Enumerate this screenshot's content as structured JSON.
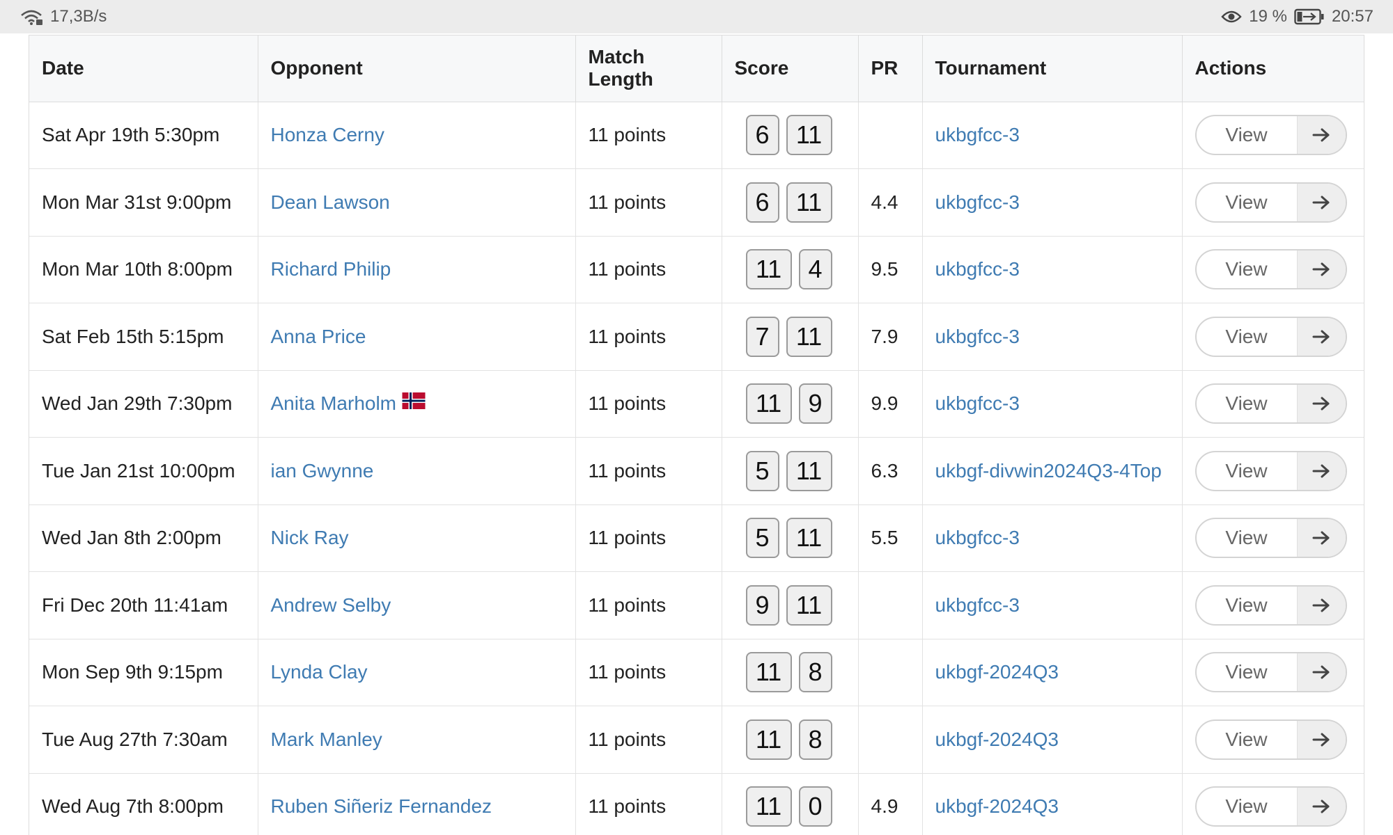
{
  "statusbar": {
    "net_speed": "17,3B/s",
    "battery_percent": "19 %",
    "time": "20:57"
  },
  "table": {
    "headers": {
      "date": "Date",
      "opponent": "Opponent",
      "match_length": "Match Length",
      "score": "Score",
      "pr": "PR",
      "tournament": "Tournament",
      "actions": "Actions"
    },
    "view_label": "View",
    "rows": [
      {
        "date": "Sat Apr 19th 5:30pm",
        "opponent": "Honza Cerny",
        "length": "11 points",
        "score_a": "6",
        "score_b": "11",
        "pr": "",
        "tournament": "ukbgfcc-3"
      },
      {
        "date": "Mon Mar 31st 9:00pm",
        "opponent": "Dean Lawson",
        "length": "11 points",
        "score_a": "6",
        "score_b": "11",
        "pr": "4.4",
        "tournament": "ukbgfcc-3"
      },
      {
        "date": "Mon Mar 10th 8:00pm",
        "opponent": "Richard Philip",
        "length": "11 points",
        "score_a": "11",
        "score_b": "4",
        "pr": "9.5",
        "tournament": "ukbgfcc-3"
      },
      {
        "date": "Sat Feb 15th 5:15pm",
        "opponent": "Anna Price",
        "length": "11 points",
        "score_a": "7",
        "score_b": "11",
        "pr": "7.9",
        "tournament": "ukbgfcc-3"
      },
      {
        "date": "Wed Jan 29th 7:30pm",
        "opponent": "Anita Marholm",
        "length": "11 points",
        "score_a": "11",
        "score_b": "9",
        "pr": "9.9",
        "tournament": "ukbgfcc-3",
        "flag": "norway-flag-icon"
      },
      {
        "date": "Tue Jan 21st 10:00pm",
        "opponent": "ian Gwynne",
        "length": "11 points",
        "score_a": "5",
        "score_b": "11",
        "pr": "6.3",
        "tournament": "ukbgf-divwin2024Q3-4Top"
      },
      {
        "date": "Wed Jan 8th 2:00pm",
        "opponent": "Nick Ray",
        "length": "11 points",
        "score_a": "5",
        "score_b": "11",
        "pr": "5.5",
        "tournament": "ukbgfcc-3"
      },
      {
        "date": "Fri Dec 20th 11:41am",
        "opponent": "Andrew Selby",
        "length": "11 points",
        "score_a": "9",
        "score_b": "11",
        "pr": "",
        "tournament": "ukbgfcc-3"
      },
      {
        "date": "Mon Sep 9th 9:15pm",
        "opponent": "Lynda Clay",
        "length": "11 points",
        "score_a": "11",
        "score_b": "8",
        "pr": "",
        "tournament": "ukbgf-2024Q3"
      },
      {
        "date": "Tue Aug 27th 7:30am",
        "opponent": "Mark Manley",
        "length": "11 points",
        "score_a": "11",
        "score_b": "8",
        "pr": "",
        "tournament": "ukbgf-2024Q3"
      },
      {
        "date": "Wed Aug 7th 8:00pm",
        "opponent": "Ruben Siñeriz Fernandez",
        "length": "11 points",
        "score_a": "11",
        "score_b": "0",
        "pr": "4.9",
        "tournament": "ukbgf-2024Q3"
      }
    ]
  },
  "colors": {
    "link": "#3f7bb2",
    "header_bg": "#f7f8f9",
    "statusbar_bg": "#ececec"
  },
  "icons": {
    "wifi": "wifi-icon",
    "eye": "eye-icon",
    "battery": "battery-icon",
    "arrow": "arrow-right-icon"
  }
}
